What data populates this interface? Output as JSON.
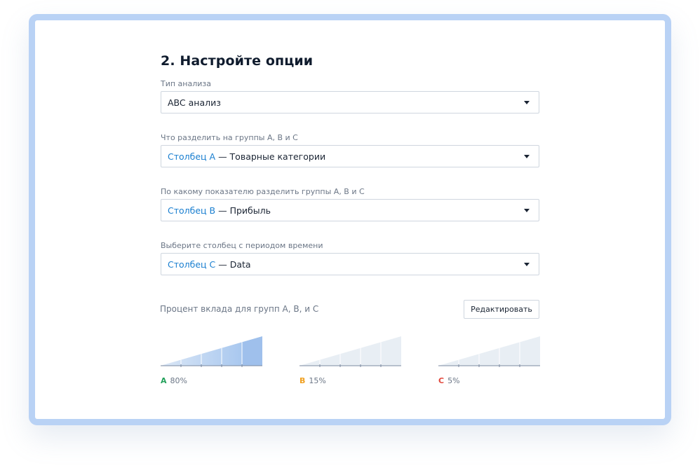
{
  "page": {
    "title": "2. Настройте опции"
  },
  "fields": [
    {
      "label": "Тип анализа",
      "value": "ABC анализ",
      "column_ref": "",
      "separator": ""
    },
    {
      "label": "Что разделить на группы A, B и C",
      "column_ref": "Столбец A",
      "separator": " — ",
      "value": "Товарные категории"
    },
    {
      "label": "По какому показателю разделить группы A, B и C",
      "column_ref": "Столбец B",
      "separator": " — ",
      "value": "Прибыль"
    },
    {
      "label": "Выберите столбец с периодом времени",
      "column_ref": "Столбец C",
      "separator": " — ",
      "value": "Data"
    }
  ],
  "icons": {
    "dropdown": "caret-down-icon"
  },
  "contribution": {
    "label": "Процент вклада для групп A, B, и C",
    "edit_button": "Редактировать",
    "groups": [
      {
        "letter": "A",
        "percent_label": "80%",
        "percent": 80,
        "color": "#22a05a",
        "fill": "#a9c8ef"
      },
      {
        "letter": "B",
        "percent_label": "15%",
        "percent": 15,
        "color": "#f0a020",
        "fill": "#e3ebf4"
      },
      {
        "letter": "C",
        "percent_label": "5%",
        "percent": 5,
        "color": "#e2483d",
        "fill": "#e3ebf4"
      }
    ]
  },
  "colors": {
    "frame_border": "#b9d2f5",
    "column_ref": "#1a7fd0",
    "text": "#1a2433",
    "muted": "#6b7686"
  }
}
